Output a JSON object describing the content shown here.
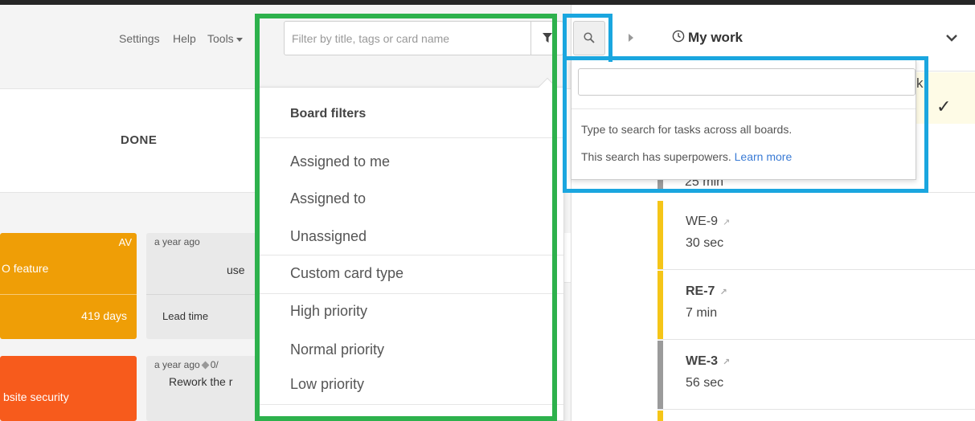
{
  "nav": {
    "settings": "Settings",
    "help": "Help",
    "tools": "Tools"
  },
  "board": {
    "column_title": "DONE",
    "cards": {
      "orange": {
        "assignee": "AV",
        "title": "O feature",
        "days": "419 days"
      },
      "red": {
        "title": "bsite security"
      },
      "gray1": {
        "meta": "a year ago",
        "body": "use",
        "lead": "Lead time"
      },
      "gray2": {
        "meta": "a year ago",
        "counter": "0/",
        "body": "Rework the r"
      }
    }
  },
  "filter": {
    "placeholder": "Filter by title, tags or card name",
    "dropdown": {
      "heading": "Board filters",
      "items": [
        "Assigned to me",
        "Assigned to",
        "Unassigned",
        "Custom card type",
        "High priority",
        "Normal priority",
        "Low priority"
      ]
    }
  },
  "my_work": {
    "title": "My work",
    "partial_letter": "k",
    "partial_time": "25 min",
    "tasks": [
      {
        "id": "WE-9",
        "time": "30 sec",
        "color": "#f5c518",
        "bold": false
      },
      {
        "id": "RE-7",
        "time": "7 min",
        "color": "#f5c518",
        "bold": true
      },
      {
        "id": "WE-3",
        "time": "56 sec",
        "color": "#9b9b9b",
        "bold": true
      }
    ]
  },
  "search_popover": {
    "value": "",
    "line1": "Type to search for tasks across all boards.",
    "line2_prefix": "This search has superpowers. ",
    "learn_more": "Learn more"
  },
  "colors": {
    "green_frame": "#2db14c",
    "blue_frame": "#1aa6df",
    "orange_card": "#ef9e06",
    "red_card": "#f75b1c",
    "link": "#3a7bd5"
  }
}
